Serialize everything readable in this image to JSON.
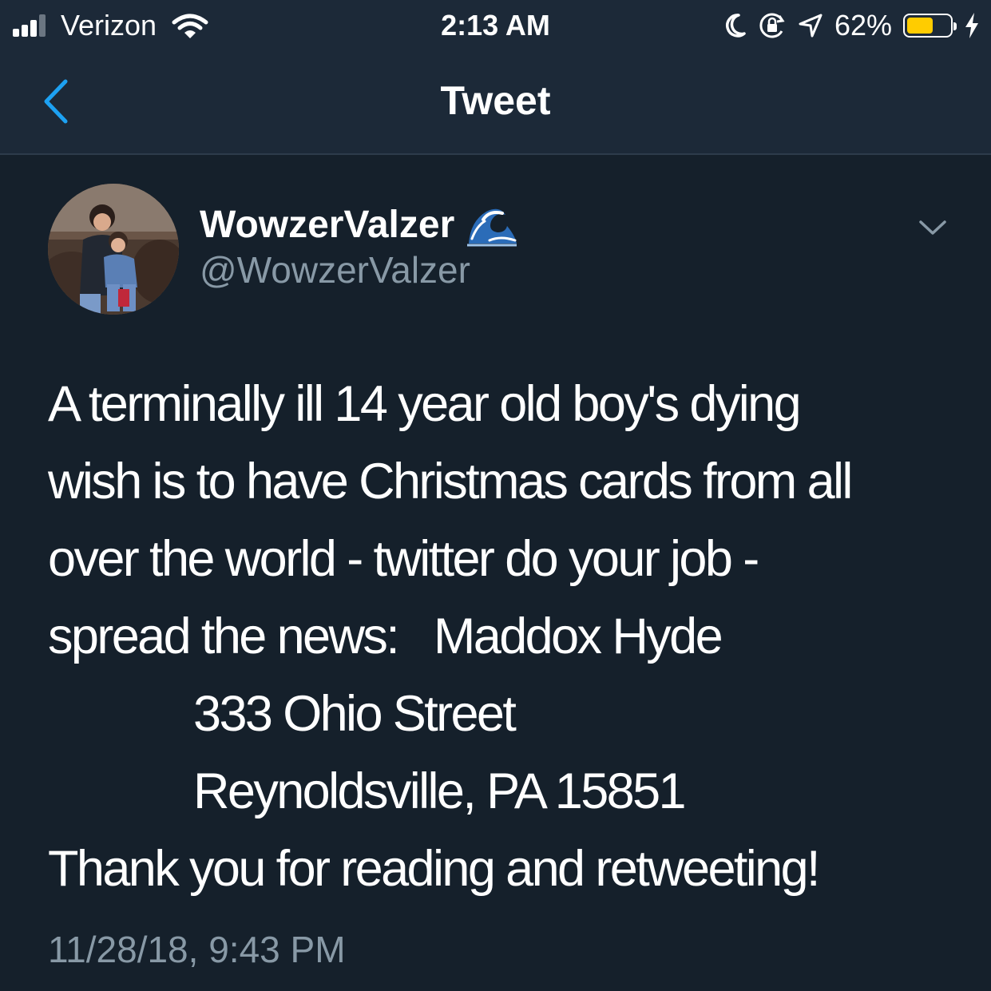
{
  "status_bar": {
    "carrier": "Verizon",
    "time": "2:13 AM",
    "battery_percent_label": "62%",
    "battery_level": 0.62,
    "signal_bars": 3,
    "icons": [
      "signal-bars-icon",
      "wifi-icon",
      "moon-icon",
      "rotation-lock-icon",
      "location-arrow-icon",
      "battery-icon",
      "charging-bolt-icon"
    ],
    "battery_color": "#ffcc00"
  },
  "nav": {
    "title": "Tweet",
    "back_icon": "chevron-left-icon",
    "accent_color": "#1da1f2"
  },
  "tweet": {
    "display_name": "WowzerValzer",
    "name_emoji": "water-wave-emoji",
    "handle": "@WowzerValzer",
    "menu_icon": "chevron-down-icon",
    "lines": [
      "A terminally ill 14 year old boy's dying",
      "wish is to have Christmas cards from all",
      "over the world - twitter do your job -",
      "spread the news:   Maddox Hyde",
      "333 Ohio Street",
      "Reynoldsville, PA 15851",
      "Thank you for reading and retweeting!"
    ],
    "timestamp": "11/28/18, 9:43 PM"
  }
}
